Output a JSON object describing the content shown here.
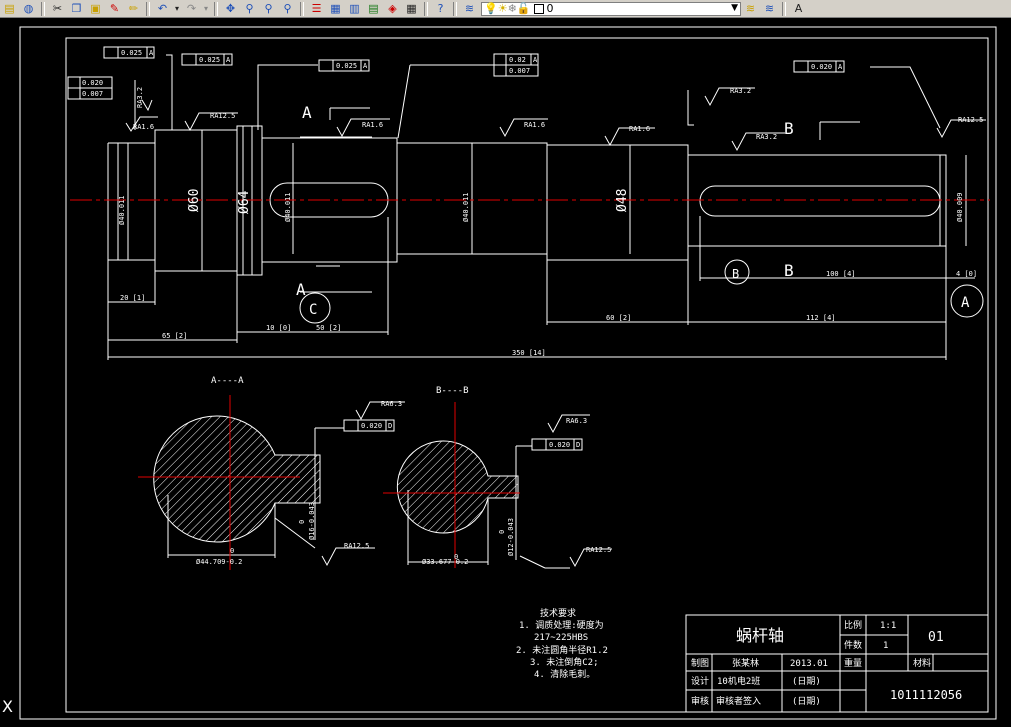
{
  "toolbar": {
    "icons": [
      "open-icon",
      "earth-icon",
      "cut-icon",
      "copy-icon",
      "paste-icon",
      "brush-icon",
      "pencil-icon",
      "undo-icon",
      "undo-dropdown-icon",
      "redo-icon",
      "pan-icon",
      "zoom-realtime-icon",
      "zoom-window-icon",
      "zoom-previous-icon",
      "properties-icon",
      "design-center-icon",
      "tool-palettes-icon",
      "sheet-set-icon",
      "markup-icon",
      "calculator-icon",
      "help-icon"
    ],
    "layer_value": "0",
    "layer_colors": {
      "bulb": "#e8e000",
      "sun": "#e0c000",
      "lock": "#c0c0c0",
      "swatch": "#ffffff"
    }
  },
  "drawing": {
    "colors": {
      "outline": "#ffffff",
      "center": "#e00000",
      "hatch": "#ffffff"
    },
    "section_labels": {
      "a": "A",
      "b": "B",
      "c": "C",
      "a_circle": "A",
      "b_circle": "B"
    },
    "diameters": {
      "d1": "Ø60",
      "d2": "Ø64",
      "d3": "Ø48"
    },
    "small_labels": {
      "tol1": "Ø40.011",
      "tol2": "Ø40.011",
      "tol3": "Ø40.011",
      "tol4": "Ø40.011",
      "tol5": "Ø40.009",
      "rough_ra16_a": "RA1.6",
      "rough_ra125_a": "RA12.5",
      "rough_ra16_b": "RA1.6",
      "rough_ra16_c": "RA1.6",
      "rough_ra16_d": "RA1.6",
      "rough_ra32_a": "RA3.2",
      "rough_ra32_b": "RA3.2",
      "rough_ra125_b": "RA12.5",
      "rough_ra32_left": "RA3.2",
      "rough_ra63_a": "RA6.3",
      "rough_ra63_b": "RA6.3",
      "rough_ra125_c": "RA12.5",
      "rough_ra125_d": "RA12.5",
      "fc1": "0.025",
      "fc2": "0.020",
      "fc3": "0.007",
      "fc4": "0.025",
      "fc5": "0.025",
      "fc6": "0.02",
      "fc7": "0.007",
      "fc8": "0.020",
      "fc9": "0.020",
      "fc10": "0.020",
      "datum_a": "A",
      "datum_d": "D",
      "dim_20": "20 [1]",
      "dim_65": "65 [2]",
      "dim_10": "10 [0]",
      "dim_50": "50 [2]",
      "dim_60": "60 [2]",
      "dim_112": "112 [4]",
      "dim_350": "350 [14]",
      "dim_100": "100 [4]",
      "dim_4": "4 [0]",
      "sec_aa_title": "A----A",
      "sec_bb_title": "B----B",
      "sec_aa_dia": "Ø44.709-0.2",
      "sec_bb_dia": "Ø33.677-0.2",
      "sec_aa_key": "Ø16-0.043",
      "sec_bb_key": "Ø12-0.043",
      "zero1": "0",
      "zero2": "0",
      "zero3": "0",
      "zero4": "0"
    },
    "tech_req": {
      "title": "技术要求",
      "line1": "1. 调质处理:硬度为",
      "line2": "217~225HBS",
      "line3": "2. 未注圆角半径R1.2",
      "line4": "3. 未注倒角C2;",
      "line5": "4. 清除毛刺。"
    },
    "title_block": {
      "part_name": "蜗杆轴",
      "scale_label": "比例",
      "scale_value": "1:1",
      "qty_label": "件数",
      "qty_value": "1",
      "drawing_no": "01",
      "weight_label": "重量",
      "material_label": "材料",
      "drawn_label": "制图",
      "drawn_name": "张某林",
      "drawn_date": "2013.01",
      "design_label": "设计",
      "design_name": "10机电2班",
      "design_date": "(日期)",
      "check_label": "审核",
      "check_name": "审核者签入",
      "check_date": "(日期)",
      "code": "1011112056"
    }
  }
}
